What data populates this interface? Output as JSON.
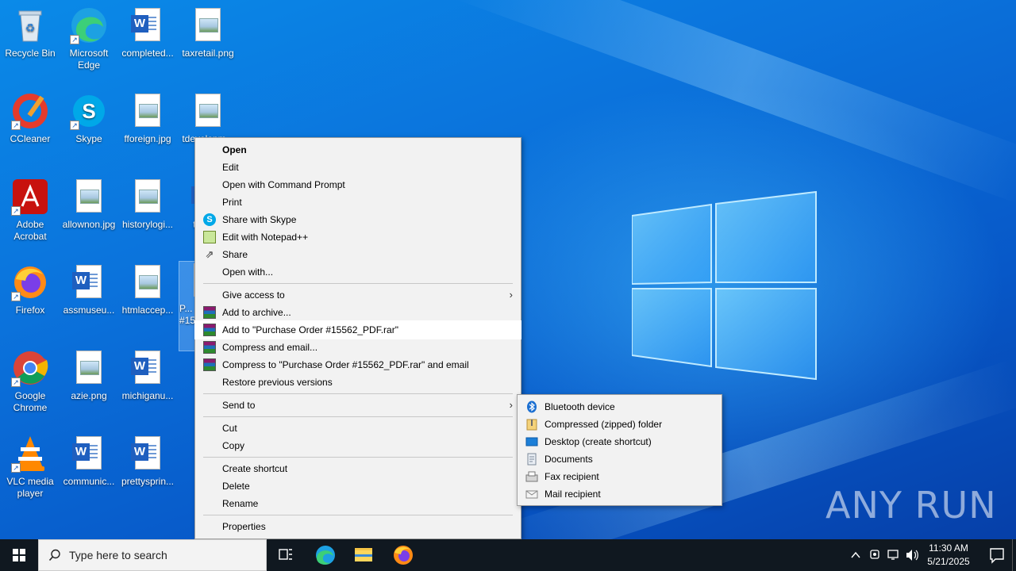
{
  "desktop": {
    "icons": [
      {
        "label": "Recycle Bin",
        "icon": "recycle-bin-icon"
      },
      {
        "label": "Microsoft Edge",
        "icon": "edge-icon"
      },
      {
        "label": "completed...",
        "icon": "word-document-icon"
      },
      {
        "label": "taxretail.png",
        "icon": "image-file-icon"
      },
      {
        "label": "CCleaner",
        "icon": "ccleaner-icon"
      },
      {
        "label": "Skype",
        "icon": "skype-icon"
      },
      {
        "label": "fforeign.jpg",
        "icon": "image-file-icon"
      },
      {
        "label": "tdevelopm...",
        "icon": "image-file-icon"
      },
      {
        "label": "Adobe Acrobat",
        "icon": "acrobat-icon"
      },
      {
        "label": "allownon.jpg",
        "icon": "image-file-icon"
      },
      {
        "label": "historylogi...",
        "icon": "image-file-icon"
      },
      {
        "label": "throu...",
        "icon": "word-document-icon"
      },
      {
        "label": "Firefox",
        "icon": "firefox-icon"
      },
      {
        "label": "assmuseu...",
        "icon": "word-document-icon"
      },
      {
        "label": "htmlaccep...",
        "icon": "image-file-icon"
      },
      {
        "label": "P... #15...",
        "icon": "pdf-file-icon"
      },
      {
        "label": "Google Chrome",
        "icon": "chrome-icon"
      },
      {
        "label": "azie.png",
        "icon": "image-file-icon"
      },
      {
        "label": "michiganu...",
        "icon": "word-document-icon"
      },
      {
        "label": "VLC media player",
        "icon": "vlc-icon"
      },
      {
        "label": "communic...",
        "icon": "word-document-icon"
      },
      {
        "label": "prettysprin...",
        "icon": "word-document-icon"
      }
    ]
  },
  "context_menu": {
    "open": "Open",
    "edit": "Edit",
    "open_cmd": "Open with Command Prompt",
    "print": "Print",
    "share_skype": "Share with Skype",
    "edit_notepad": "Edit with Notepad++",
    "share": "Share",
    "open_with": "Open with...",
    "give_access": "Give access to",
    "add_archive": "Add to archive...",
    "add_to_rar": "Add to \"Purchase Order #15562_PDF.rar\"",
    "compress_email": "Compress and email...",
    "compress_rar_email": "Compress to \"Purchase Order #15562_PDF.rar\" and email",
    "restore_versions": "Restore previous versions",
    "send_to": "Send to",
    "cut": "Cut",
    "copy": "Copy",
    "create_shortcut": "Create shortcut",
    "delete": "Delete",
    "rename": "Rename",
    "properties": "Properties"
  },
  "send_to_menu": {
    "bluetooth": "Bluetooth device",
    "zip": "Compressed (zipped) folder",
    "desktop": "Desktop (create shortcut)",
    "documents": "Documents",
    "fax": "Fax recipient",
    "mail": "Mail recipient"
  },
  "taskbar": {
    "search_placeholder": "Type here to search",
    "time": "11:30 AM",
    "date": "5/21/2025"
  },
  "watermark": "ANY RUN",
  "colors": {
    "wallpaper": "#0b73dc",
    "menu_bg": "#f2f2f2",
    "taskbar": "#101820"
  }
}
